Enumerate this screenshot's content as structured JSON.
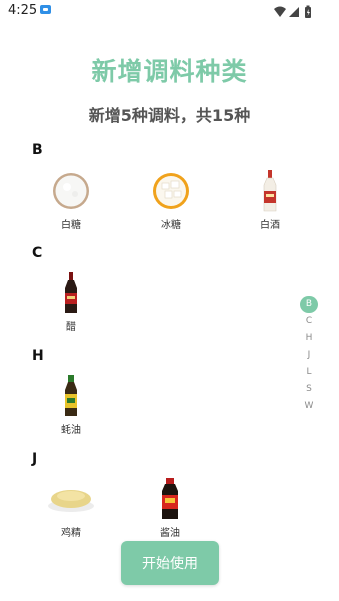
{
  "status": {
    "time": "4:25"
  },
  "header": {
    "title": "新增调料种类",
    "subtitle": "新增5种调料，共15种"
  },
  "sections": [
    {
      "letter": "B",
      "items": [
        {
          "label": "白糖",
          "icon": "white-sugar-icon"
        },
        {
          "label": "冰糖",
          "icon": "rock-sugar-icon"
        },
        {
          "label": "白酒",
          "icon": "liquor-bottle-icon"
        }
      ]
    },
    {
      "letter": "C",
      "items": [
        {
          "label": "醋",
          "icon": "vinegar-bottle-icon"
        }
      ]
    },
    {
      "letter": "H",
      "items": [
        {
          "label": "蚝油",
          "icon": "oyster-sauce-icon"
        }
      ]
    },
    {
      "letter": "J",
      "items": [
        {
          "label": "鸡精",
          "icon": "chicken-essence-icon"
        },
        {
          "label": "酱油",
          "icon": "soy-sauce-icon"
        }
      ]
    }
  ],
  "index_bar": {
    "letters": [
      "B",
      "C",
      "H",
      "J",
      "L",
      "S",
      "W"
    ],
    "active": "B"
  },
  "actions": {
    "start_label": "开始使用"
  },
  "colors": {
    "accent": "#7ecaa8"
  }
}
